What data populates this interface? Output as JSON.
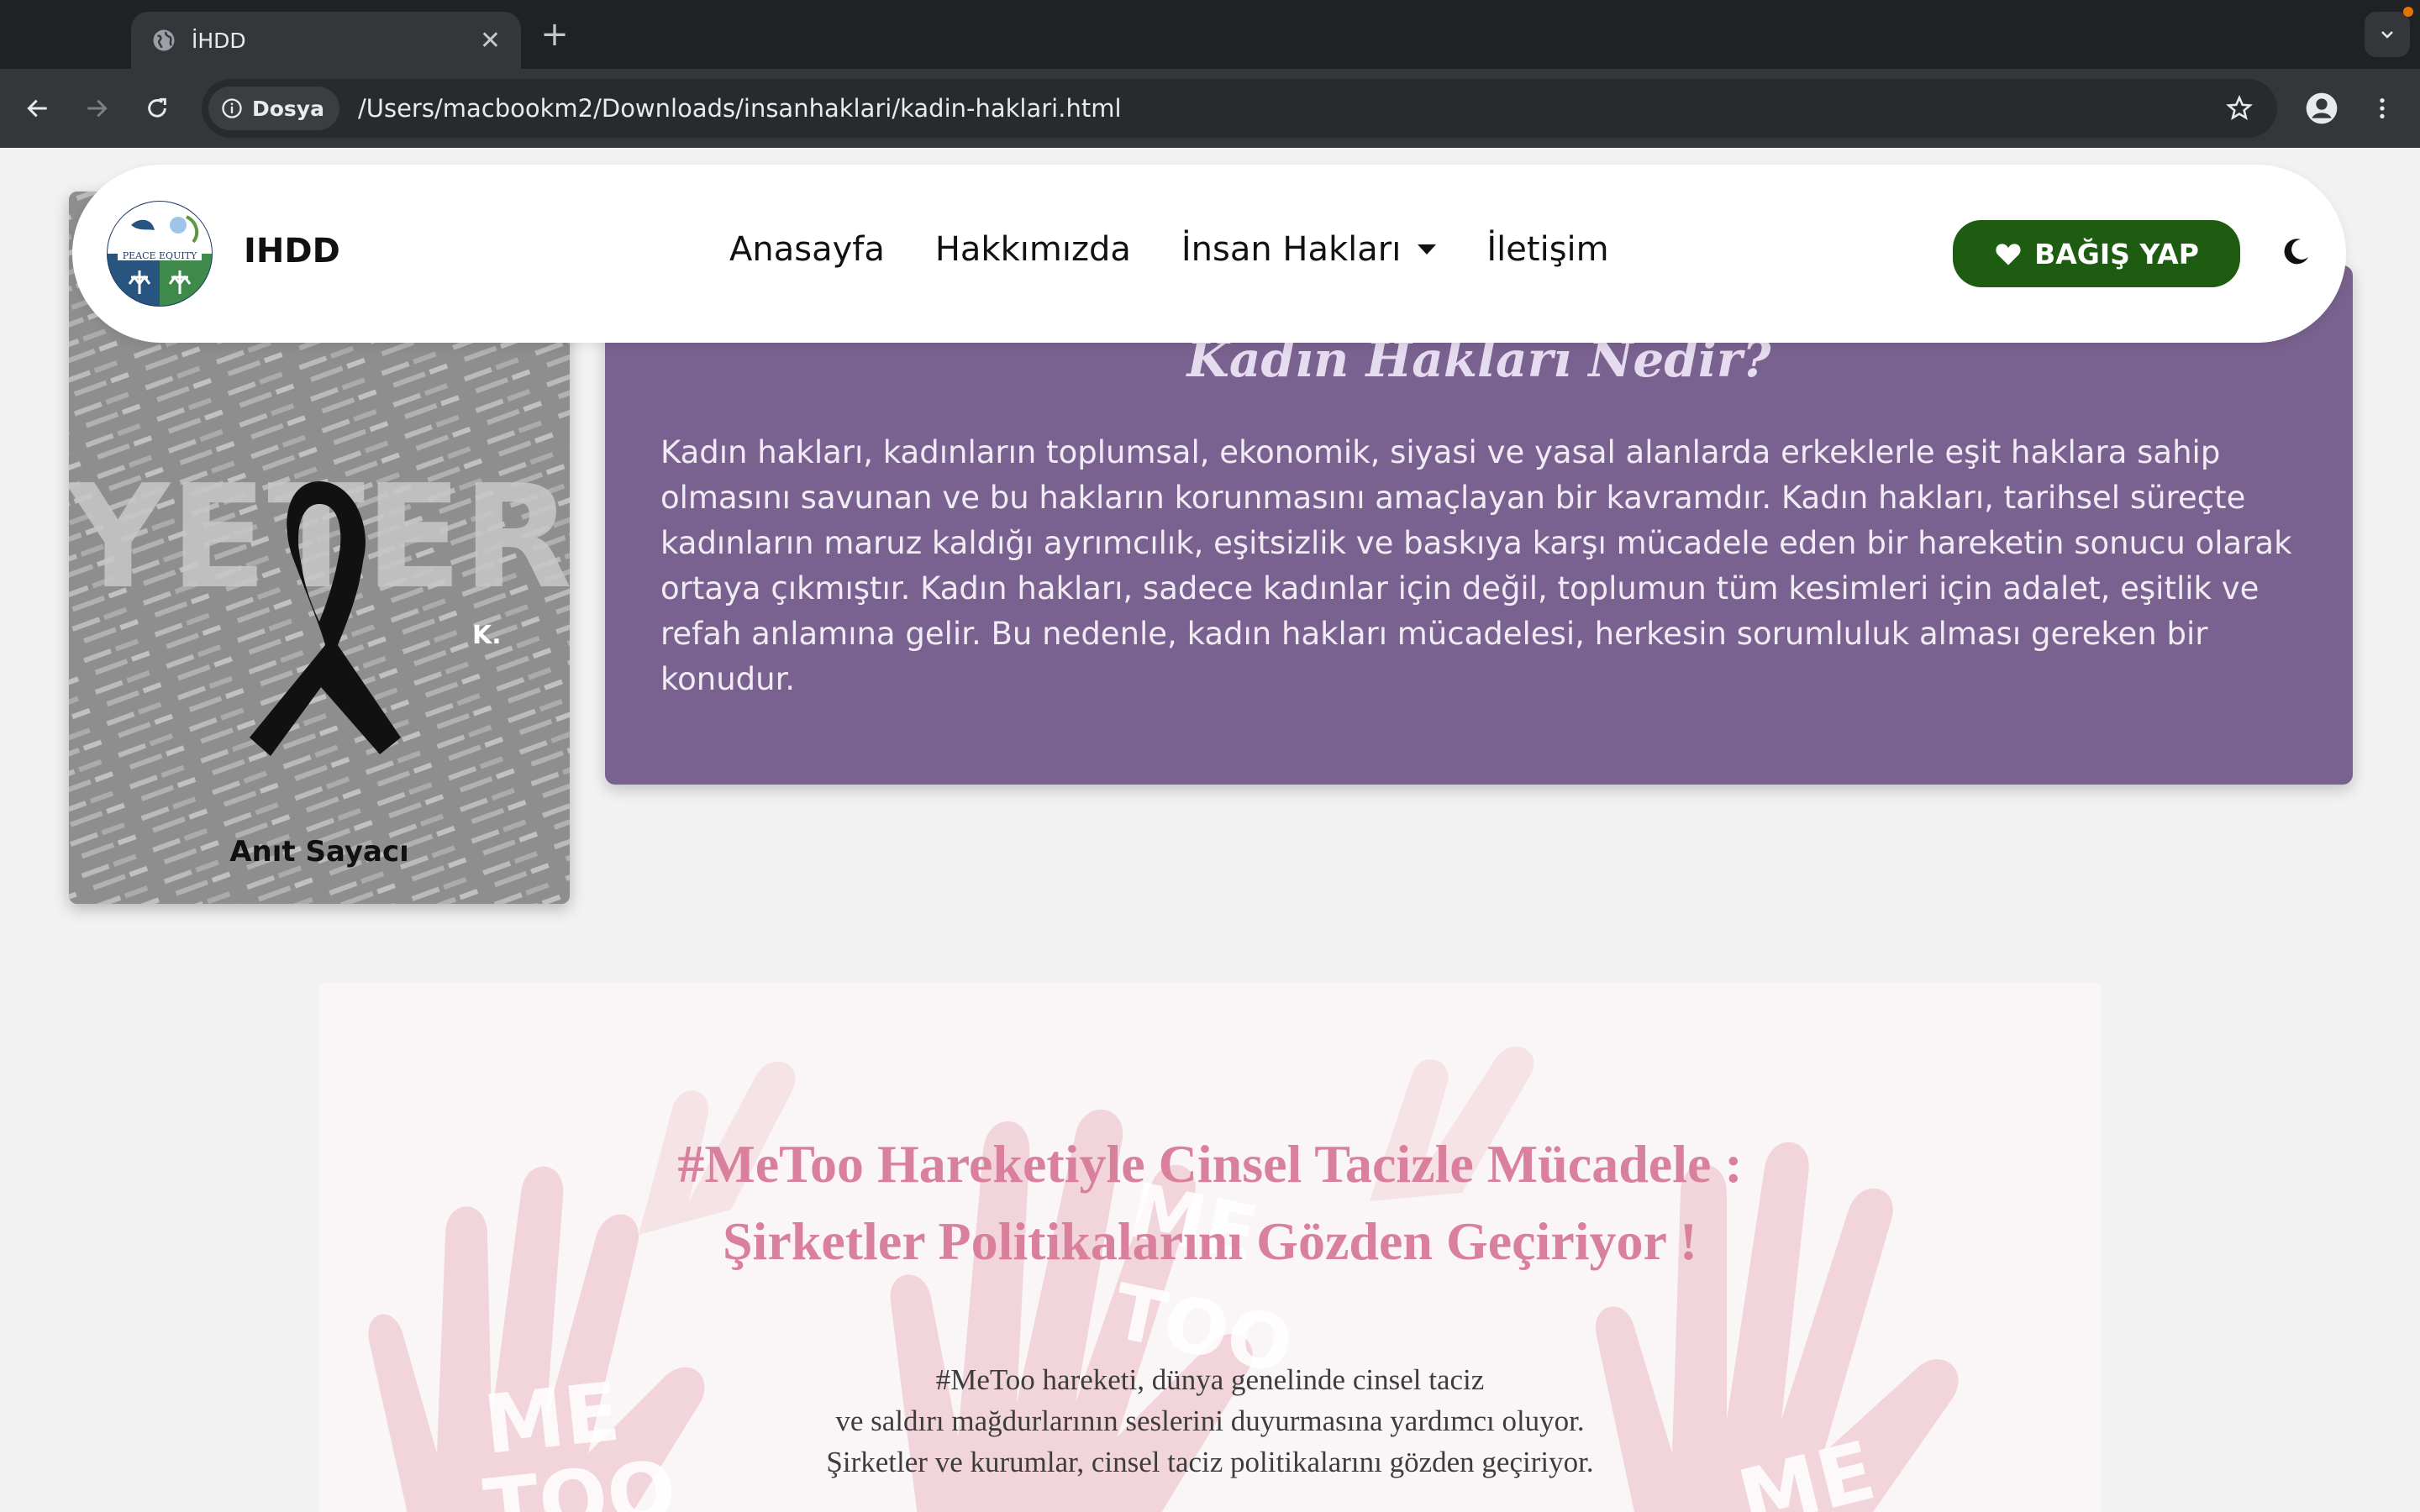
{
  "browser": {
    "tab_title": "İHDD",
    "chip_label": "Dosya",
    "url": "/Users/macbookm2/Downloads/insanhaklari/kadin-haklari.html"
  },
  "header": {
    "brand": "IHDD",
    "logo_text": "PEACE EQUITY",
    "nav": [
      "Anasayfa",
      "Hakkımızda",
      "İnsan Hakları",
      "İletişim"
    ],
    "donate_label": "BAĞIŞ YAP"
  },
  "memorial": {
    "label": "Anıt Sayacı",
    "big_text": "YETER",
    "initial": "K."
  },
  "info": {
    "title": "Kadın Hakları Nedir?",
    "body": "Kadın hakları, kadınların toplumsal, ekonomik, siyasi ve yasal alanlarda erkeklerle eşit haklara sahip olmasını savunan ve bu hakların korunmasını amaçlayan bir kavramdır. Kadın hakları, tarihsel süreçte kadınların maruz kaldığı ayrımcılık, eşitsizlik ve baskıya karşı mücadele eden bir hareketin sonucu olarak ortaya çıkmıştır. Kadın hakları, sadece kadınlar için değil, toplumun tüm kesimleri için adalet, eşitlik ve refah anlamına gelir. Bu nedenle, kadın hakları mücadelesi, herkesin sorumluluk alması gereken bir konudur."
  },
  "banner": {
    "title_lines": [
      "#MeToo Hareketiyle Cinsel Tacizle Mücadele :",
      "Şirketler Politikalarını Gözden Geçiriyor !"
    ],
    "text_lines": [
      "#MeToo hareketi, dünya genelinde cinsel taciz",
      "ve saldırı mağdurlarının seslerini duyurmasına yardımcı oluyor.",
      "Şirketler ve kurumlar, cinsel taciz politikalarını gözden geçiriyor."
    ],
    "watermark": "ME TOO"
  },
  "colors": {
    "accent_purple": "#7a6290",
    "donate_green": "#1e5c12",
    "banner_title": "#d9809f"
  }
}
